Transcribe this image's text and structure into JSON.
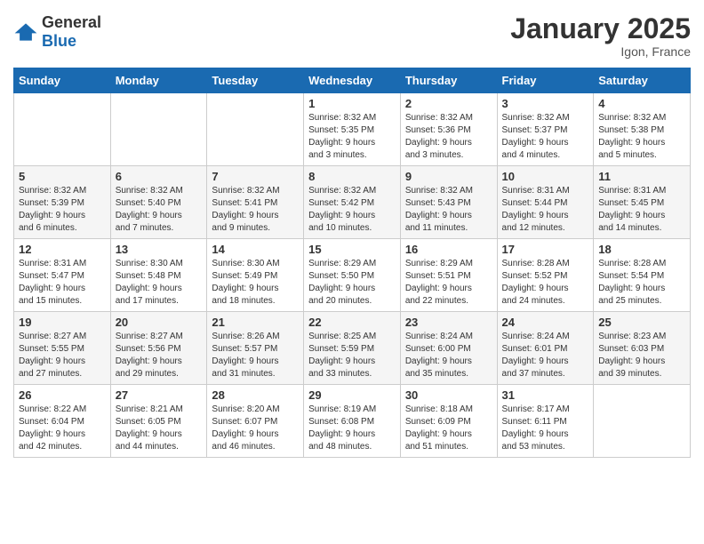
{
  "header": {
    "logo_general": "General",
    "logo_blue": "Blue",
    "month_title": "January 2025",
    "location": "Igon, France"
  },
  "days_of_week": [
    "Sunday",
    "Monday",
    "Tuesday",
    "Wednesday",
    "Thursday",
    "Friday",
    "Saturday"
  ],
  "weeks": [
    [
      {
        "day": "",
        "info": ""
      },
      {
        "day": "",
        "info": ""
      },
      {
        "day": "",
        "info": ""
      },
      {
        "day": "1",
        "info": "Sunrise: 8:32 AM\nSunset: 5:35 PM\nDaylight: 9 hours\nand 3 minutes."
      },
      {
        "day": "2",
        "info": "Sunrise: 8:32 AM\nSunset: 5:36 PM\nDaylight: 9 hours\nand 3 minutes."
      },
      {
        "day": "3",
        "info": "Sunrise: 8:32 AM\nSunset: 5:37 PM\nDaylight: 9 hours\nand 4 minutes."
      },
      {
        "day": "4",
        "info": "Sunrise: 8:32 AM\nSunset: 5:38 PM\nDaylight: 9 hours\nand 5 minutes."
      }
    ],
    [
      {
        "day": "5",
        "info": "Sunrise: 8:32 AM\nSunset: 5:39 PM\nDaylight: 9 hours\nand 6 minutes."
      },
      {
        "day": "6",
        "info": "Sunrise: 8:32 AM\nSunset: 5:40 PM\nDaylight: 9 hours\nand 7 minutes."
      },
      {
        "day": "7",
        "info": "Sunrise: 8:32 AM\nSunset: 5:41 PM\nDaylight: 9 hours\nand 9 minutes."
      },
      {
        "day": "8",
        "info": "Sunrise: 8:32 AM\nSunset: 5:42 PM\nDaylight: 9 hours\nand 10 minutes."
      },
      {
        "day": "9",
        "info": "Sunrise: 8:32 AM\nSunset: 5:43 PM\nDaylight: 9 hours\nand 11 minutes."
      },
      {
        "day": "10",
        "info": "Sunrise: 8:31 AM\nSunset: 5:44 PM\nDaylight: 9 hours\nand 12 minutes."
      },
      {
        "day": "11",
        "info": "Sunrise: 8:31 AM\nSunset: 5:45 PM\nDaylight: 9 hours\nand 14 minutes."
      }
    ],
    [
      {
        "day": "12",
        "info": "Sunrise: 8:31 AM\nSunset: 5:47 PM\nDaylight: 9 hours\nand 15 minutes."
      },
      {
        "day": "13",
        "info": "Sunrise: 8:30 AM\nSunset: 5:48 PM\nDaylight: 9 hours\nand 17 minutes."
      },
      {
        "day": "14",
        "info": "Sunrise: 8:30 AM\nSunset: 5:49 PM\nDaylight: 9 hours\nand 18 minutes."
      },
      {
        "day": "15",
        "info": "Sunrise: 8:29 AM\nSunset: 5:50 PM\nDaylight: 9 hours\nand 20 minutes."
      },
      {
        "day": "16",
        "info": "Sunrise: 8:29 AM\nSunset: 5:51 PM\nDaylight: 9 hours\nand 22 minutes."
      },
      {
        "day": "17",
        "info": "Sunrise: 8:28 AM\nSunset: 5:52 PM\nDaylight: 9 hours\nand 24 minutes."
      },
      {
        "day": "18",
        "info": "Sunrise: 8:28 AM\nSunset: 5:54 PM\nDaylight: 9 hours\nand 25 minutes."
      }
    ],
    [
      {
        "day": "19",
        "info": "Sunrise: 8:27 AM\nSunset: 5:55 PM\nDaylight: 9 hours\nand 27 minutes."
      },
      {
        "day": "20",
        "info": "Sunrise: 8:27 AM\nSunset: 5:56 PM\nDaylight: 9 hours\nand 29 minutes."
      },
      {
        "day": "21",
        "info": "Sunrise: 8:26 AM\nSunset: 5:57 PM\nDaylight: 9 hours\nand 31 minutes."
      },
      {
        "day": "22",
        "info": "Sunrise: 8:25 AM\nSunset: 5:59 PM\nDaylight: 9 hours\nand 33 minutes."
      },
      {
        "day": "23",
        "info": "Sunrise: 8:24 AM\nSunset: 6:00 PM\nDaylight: 9 hours\nand 35 minutes."
      },
      {
        "day": "24",
        "info": "Sunrise: 8:24 AM\nSunset: 6:01 PM\nDaylight: 9 hours\nand 37 minutes."
      },
      {
        "day": "25",
        "info": "Sunrise: 8:23 AM\nSunset: 6:03 PM\nDaylight: 9 hours\nand 39 minutes."
      }
    ],
    [
      {
        "day": "26",
        "info": "Sunrise: 8:22 AM\nSunset: 6:04 PM\nDaylight: 9 hours\nand 42 minutes."
      },
      {
        "day": "27",
        "info": "Sunrise: 8:21 AM\nSunset: 6:05 PM\nDaylight: 9 hours\nand 44 minutes."
      },
      {
        "day": "28",
        "info": "Sunrise: 8:20 AM\nSunset: 6:07 PM\nDaylight: 9 hours\nand 46 minutes."
      },
      {
        "day": "29",
        "info": "Sunrise: 8:19 AM\nSunset: 6:08 PM\nDaylight: 9 hours\nand 48 minutes."
      },
      {
        "day": "30",
        "info": "Sunrise: 8:18 AM\nSunset: 6:09 PM\nDaylight: 9 hours\nand 51 minutes."
      },
      {
        "day": "31",
        "info": "Sunrise: 8:17 AM\nSunset: 6:11 PM\nDaylight: 9 hours\nand 53 minutes."
      },
      {
        "day": "",
        "info": ""
      }
    ]
  ]
}
